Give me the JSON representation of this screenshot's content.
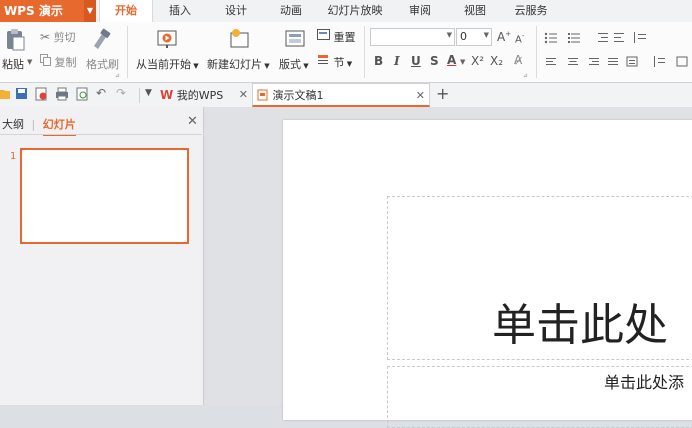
{
  "app": {
    "name": "WPS 演示",
    "dropdown_icon": "chevron-down-icon"
  },
  "menu": {
    "tabs": [
      "开始",
      "插入",
      "设计",
      "动画",
      "幻灯片放映",
      "审阅",
      "视图",
      "云服务"
    ],
    "active": "开始"
  },
  "ribbon": {
    "paste": "粘贴",
    "cut": "剪切",
    "copy": "复制",
    "format_painter": "格式刷",
    "from_current": "从当前开始",
    "new_slide": "新建幻灯片",
    "layout": "版式",
    "reset": "重置",
    "section": "节",
    "font_size": "0",
    "bold": "B",
    "italic": "I",
    "underline": "U",
    "strike": "S",
    "font_color": "A",
    "superscript": "X²",
    "subscript": "X₂"
  },
  "doc_tabs": [
    {
      "label": "我的WPS"
    },
    {
      "label": "演示文稿1"
    }
  ],
  "left_panel": {
    "tab_outline": "大纲",
    "tab_slides": "幻灯片",
    "slide_number": "1"
  },
  "slide": {
    "title_placeholder": "单击此处",
    "subtitle_placeholder": "单击此处添"
  },
  "colors": {
    "accent": "#e8692d"
  }
}
